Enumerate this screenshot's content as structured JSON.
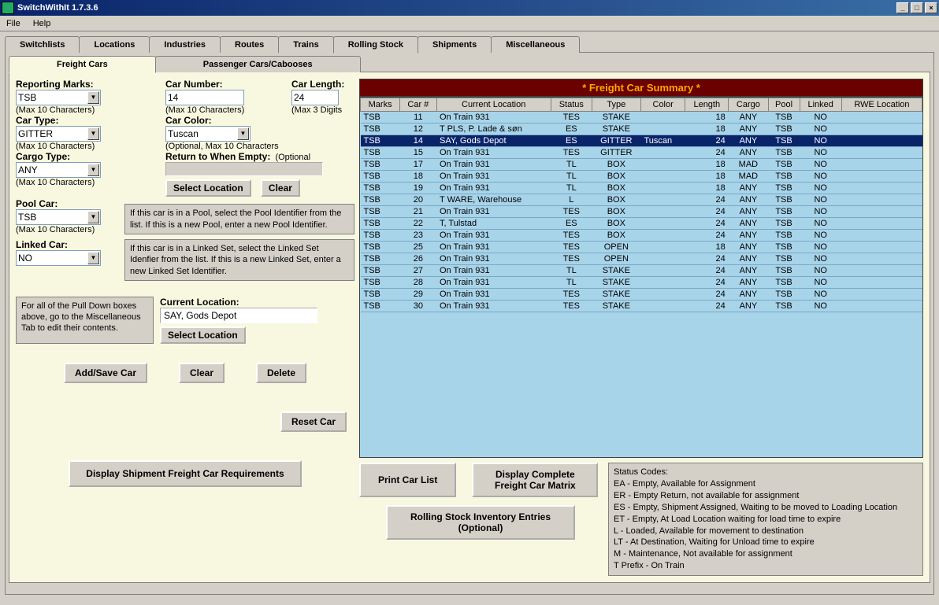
{
  "window": {
    "title": "SwitchWithIt 1.7.3.6"
  },
  "menu": {
    "file": "File",
    "help": "Help"
  },
  "tabs": [
    "Switchlists",
    "Locations",
    "Industries",
    "Routes",
    "Trains",
    "Rolling Stock",
    "Shipments",
    "Miscellaneous"
  ],
  "activeTab": "Rolling Stock",
  "subtabs": [
    "Freight Cars",
    "Passenger Cars/Cabooses"
  ],
  "activeSubtab": "Freight Cars",
  "form": {
    "reportingMarks": {
      "label": "Reporting Marks:",
      "value": "TSB",
      "hint": "(Max 10 Characters)"
    },
    "carNumber": {
      "label": "Car Number:",
      "value": "14",
      "hint": "(Max 10 Characters)"
    },
    "carLength": {
      "label": "Car Length:",
      "value": "24",
      "hint": "(Max 3 Digits"
    },
    "carType": {
      "label": "Car Type:",
      "value": "GITTER",
      "hint": "(Max 10 Characters)"
    },
    "carColor": {
      "label": "Car Color:",
      "value": "Tuscan",
      "hint": "(Optional, Max 10 Characters"
    },
    "cargoType": {
      "label": "Cargo Type:",
      "value": "ANY",
      "hint": "(Max 10 Characters)"
    },
    "returnEmpty": {
      "label": "Return to When Empty:",
      "hint": "(Optional",
      "value": ""
    },
    "poolCar": {
      "label": "Pool Car:",
      "value": "TSB",
      "hint": "(Max 10 Characters)",
      "info": "If this car is in a Pool, select the Pool Identifier from the list.  If this is a new Pool, enter a new Pool Identifier."
    },
    "linkedCar": {
      "label": "Linked Car:",
      "value": "NO",
      "info": "If this car is in a Linked Set, select the Linked Set Idenfier from the list.  If this is a new Linked Set, enter a new Linked Set Identifier."
    },
    "currentLocation": {
      "label": "Current Location:",
      "value": "SAY, Gods Depot"
    },
    "miscHint": "For all of the Pull Down boxes above, go to the Miscellaneous Tab to edit their contents.",
    "buttons": {
      "selectLocation": "Select Location",
      "clear": "Clear",
      "addSave": "Add/Save Car",
      "delete": "Delete",
      "resetCar": "Reset Car",
      "printCarList": "Print Car List",
      "displayMatrix": "Display Complete Freight Car Matrix",
      "displayReq": "Display Shipment Freight Car Requirements",
      "inventory": "Rolling Stock Inventory Entries (Optional)"
    }
  },
  "summary": {
    "title": "* Freight Car Summary *",
    "columns": [
      "Marks",
      "Car #",
      "Current Location",
      "Status",
      "Type",
      "Color",
      "Length",
      "Cargo",
      "Pool",
      "Linked",
      "RWE Location"
    ],
    "selectedIndex": 2,
    "rows": [
      {
        "marks": "TSB",
        "car": "11",
        "loc": "On Train 931",
        "status": "TES",
        "type": "STAKE",
        "color": "",
        "length": "18",
        "cargo": "ANY",
        "pool": "TSB",
        "linked": "NO",
        "rwe": ""
      },
      {
        "marks": "TSB",
        "car": "12",
        "loc": "T PLS, P. Lade & søn",
        "status": "ES",
        "type": "STAKE",
        "color": "",
        "length": "18",
        "cargo": "ANY",
        "pool": "TSB",
        "linked": "NO",
        "rwe": ""
      },
      {
        "marks": "TSB",
        "car": "14",
        "loc": "SAY, Gods Depot",
        "status": "ES",
        "type": "GITTER",
        "color": "Tuscan",
        "length": "24",
        "cargo": "ANY",
        "pool": "TSB",
        "linked": "NO",
        "rwe": ""
      },
      {
        "marks": "TSB",
        "car": "15",
        "loc": "On Train 931",
        "status": "TES",
        "type": "GITTER",
        "color": "",
        "length": "24",
        "cargo": "ANY",
        "pool": "TSB",
        "linked": "NO",
        "rwe": ""
      },
      {
        "marks": "TSB",
        "car": "17",
        "loc": "On Train 931",
        "status": "TL",
        "type": "BOX",
        "color": "",
        "length": "18",
        "cargo": "MAD",
        "pool": "TSB",
        "linked": "NO",
        "rwe": ""
      },
      {
        "marks": "TSB",
        "car": "18",
        "loc": "On Train 931",
        "status": "TL",
        "type": "BOX",
        "color": "",
        "length": "18",
        "cargo": "MAD",
        "pool": "TSB",
        "linked": "NO",
        "rwe": ""
      },
      {
        "marks": "TSB",
        "car": "19",
        "loc": "On Train 931",
        "status": "TL",
        "type": "BOX",
        "color": "",
        "length": "18",
        "cargo": "ANY",
        "pool": "TSB",
        "linked": "NO",
        "rwe": ""
      },
      {
        "marks": "TSB",
        "car": "20",
        "loc": "T WARE, Warehouse",
        "status": "L",
        "type": "BOX",
        "color": "",
        "length": "24",
        "cargo": "ANY",
        "pool": "TSB",
        "linked": "NO",
        "rwe": ""
      },
      {
        "marks": "TSB",
        "car": "21",
        "loc": "On Train 931",
        "status": "TES",
        "type": "BOX",
        "color": "",
        "length": "24",
        "cargo": "ANY",
        "pool": "TSB",
        "linked": "NO",
        "rwe": ""
      },
      {
        "marks": "TSB",
        "car": "22",
        "loc": "T, Tulstad",
        "status": "ES",
        "type": "BOX",
        "color": "",
        "length": "24",
        "cargo": "ANY",
        "pool": "TSB",
        "linked": "NO",
        "rwe": ""
      },
      {
        "marks": "TSB",
        "car": "23",
        "loc": "On Train 931",
        "status": "TES",
        "type": "BOX",
        "color": "",
        "length": "24",
        "cargo": "ANY",
        "pool": "TSB",
        "linked": "NO",
        "rwe": ""
      },
      {
        "marks": "TSB",
        "car": "25",
        "loc": "On Train 931",
        "status": "TES",
        "type": "OPEN",
        "color": "",
        "length": "18",
        "cargo": "ANY",
        "pool": "TSB",
        "linked": "NO",
        "rwe": ""
      },
      {
        "marks": "TSB",
        "car": "26",
        "loc": "On Train 931",
        "status": "TES",
        "type": "OPEN",
        "color": "",
        "length": "24",
        "cargo": "ANY",
        "pool": "TSB",
        "linked": "NO",
        "rwe": ""
      },
      {
        "marks": "TSB",
        "car": "27",
        "loc": "On Train 931",
        "status": "TL",
        "type": "STAKE",
        "color": "",
        "length": "24",
        "cargo": "ANY",
        "pool": "TSB",
        "linked": "NO",
        "rwe": ""
      },
      {
        "marks": "TSB",
        "car": "28",
        "loc": "On Train 931",
        "status": "TL",
        "type": "STAKE",
        "color": "",
        "length": "24",
        "cargo": "ANY",
        "pool": "TSB",
        "linked": "NO",
        "rwe": ""
      },
      {
        "marks": "TSB",
        "car": "29",
        "loc": "On Train 931",
        "status": "TES",
        "type": "STAKE",
        "color": "",
        "length": "24",
        "cargo": "ANY",
        "pool": "TSB",
        "linked": "NO",
        "rwe": ""
      },
      {
        "marks": "TSB",
        "car": "30",
        "loc": "On Train 931",
        "status": "TES",
        "type": "STAKE",
        "color": "",
        "length": "24",
        "cargo": "ANY",
        "pool": "TSB",
        "linked": "NO",
        "rwe": ""
      }
    ]
  },
  "statusCodes": {
    "title": "Status Codes:",
    "lines": [
      "EA - Empty, Available for Assignment",
      "ER - Empty Return, not available for assignment",
      "ES - Empty, Shipment Assigned, Waiting to be moved to Loading Location",
      "ET - Empty, At Load Location waiting for load time to expire",
      "L - Loaded, Available for movement to destination",
      "LT - At Destination, Waiting for Unload time to expire",
      "M - Maintenance, Not available for assignment",
      "T Prefix - On Train"
    ]
  }
}
